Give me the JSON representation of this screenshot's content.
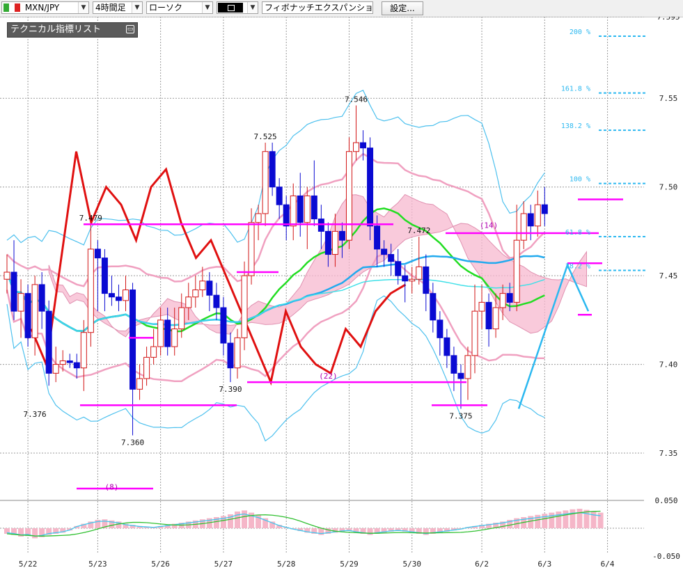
{
  "toolbar": {
    "pair": "MXN/JPY",
    "timeframe": "4時間足",
    "chart_type": "ローソク",
    "line_style": "",
    "drawing_tool": "フィボナッチエクスパンション",
    "settings_label": "設定..."
  },
  "indicator_panel": {
    "title": "テクニカル指標リスト"
  },
  "colors": {
    "bull": "#d21414",
    "bear": "#0a0ad2",
    "cloud": "#f7b8cf",
    "cloud2": "#b9d8f2",
    "bb_outer": "#4cc0ee",
    "bb_inner": "#f0a0c0",
    "ma_green": "#22dd22",
    "ma_blue": "#22aaee",
    "zigzag": "#e01010",
    "fib": "#2bb8f0",
    "level": "#ff00ff"
  },
  "chart_data": {
    "type": "candlestick",
    "ylim": [
      7.33,
      7.596
    ],
    "y_ticks": [
      {
        "v": 7.596,
        "t": "7.595"
      },
      {
        "v": 7.55,
        "t": "7.55"
      },
      {
        "v": 7.5,
        "t": "7.50"
      },
      {
        "v": 7.45,
        "t": "7.45"
      },
      {
        "v": 7.4,
        "t": "7.40"
      },
      {
        "v": 7.35,
        "t": "7.35"
      }
    ],
    "x_labels": [
      "5/22",
      "5/23",
      "5/26",
      "5/27",
      "5/28",
      "5/29",
      "5/30",
      "6/2",
      "6/3",
      "6/4"
    ],
    "x_label_index": [
      3,
      13,
      22,
      31,
      40,
      49,
      58,
      68,
      77,
      86
    ],
    "candles": [
      [
        7.448,
        7.452,
        7.462,
        7.44
      ],
      [
        7.452,
        7.43,
        7.47,
        7.425
      ],
      [
        7.43,
        7.44,
        7.448,
        7.415
      ],
      [
        7.44,
        7.415,
        7.445,
        7.41
      ],
      [
        7.415,
        7.445,
        7.45,
        7.405
      ],
      [
        7.445,
        7.43,
        7.452,
        7.42
      ],
      [
        7.43,
        7.395,
        7.436,
        7.388
      ],
      [
        7.395,
        7.4,
        7.41,
        7.39
      ],
      [
        7.4,
        7.402,
        7.408,
        7.396
      ],
      [
        7.402,
        7.401,
        7.406,
        7.398
      ],
      [
        7.401,
        7.398,
        7.406,
        7.392
      ],
      [
        7.398,
        7.418,
        7.425,
        7.385
      ],
      [
        7.418,
        7.465,
        7.479,
        7.41
      ],
      [
        7.465,
        7.46,
        7.47,
        7.43
      ],
      [
        7.46,
        7.44,
        7.465,
        7.43
      ],
      [
        7.44,
        7.438,
        7.45,
        7.433
      ],
      [
        7.438,
        7.436,
        7.445,
        7.43
      ],
      [
        7.436,
        7.442,
        7.45,
        7.43
      ],
      [
        7.442,
        7.386,
        7.446,
        7.36
      ],
      [
        7.386,
        7.392,
        7.4,
        7.38
      ],
      [
        7.392,
        7.404,
        7.41,
        7.388
      ],
      [
        7.404,
        7.41,
        7.42,
        7.4
      ],
      [
        7.41,
        7.425,
        7.432,
        7.405
      ],
      [
        7.425,
        7.41,
        7.432,
        7.405
      ],
      [
        7.41,
        7.42,
        7.432,
        7.405
      ],
      [
        7.42,
        7.432,
        7.44,
        7.415
      ],
      [
        7.432,
        7.438,
        7.446,
        7.425
      ],
      [
        7.438,
        7.442,
        7.45,
        7.432
      ],
      [
        7.442,
        7.447,
        7.455,
        7.438
      ],
      [
        7.447,
        7.439,
        7.452,
        7.43
      ],
      [
        7.439,
        7.432,
        7.446,
        7.425
      ],
      [
        7.432,
        7.412,
        7.438,
        7.405
      ],
      [
        7.412,
        7.398,
        7.418,
        7.39
      ],
      [
        7.398,
        7.415,
        7.42,
        7.392
      ],
      [
        7.415,
        7.45,
        7.458,
        7.408
      ],
      [
        7.45,
        7.48,
        7.488,
        7.445
      ],
      [
        7.48,
        7.485,
        7.49,
        7.47
      ],
      [
        7.485,
        7.52,
        7.525,
        7.478
      ],
      [
        7.52,
        7.5,
        7.525,
        7.495
      ],
      [
        7.5,
        7.49,
        7.505,
        7.482
      ],
      [
        7.49,
        7.478,
        7.495,
        7.47
      ],
      [
        7.478,
        7.495,
        7.502,
        7.47
      ],
      [
        7.495,
        7.48,
        7.508,
        7.472
      ],
      [
        7.48,
        7.495,
        7.5,
        7.465
      ],
      [
        7.495,
        7.482,
        7.515,
        7.478
      ],
      [
        7.482,
        7.475,
        7.49,
        7.465
      ],
      [
        7.475,
        7.462,
        7.48,
        7.455
      ],
      [
        7.462,
        7.475,
        7.485,
        7.455
      ],
      [
        7.475,
        7.47,
        7.48,
        7.46
      ],
      [
        7.47,
        7.52,
        7.528,
        7.465
      ],
      [
        7.52,
        7.525,
        7.546,
        7.515
      ],
      [
        7.525,
        7.522,
        7.532,
        7.515
      ],
      [
        7.522,
        7.478,
        7.528,
        7.47
      ],
      [
        7.478,
        7.465,
        7.484,
        7.455
      ],
      [
        7.465,
        7.462,
        7.47,
        7.455
      ],
      [
        7.462,
        7.458,
        7.468,
        7.45
      ],
      [
        7.458,
        7.45,
        7.465,
        7.445
      ],
      [
        7.45,
        7.447,
        7.456,
        7.435
      ],
      [
        7.447,
        7.448,
        7.455,
        7.44
      ],
      [
        7.448,
        7.455,
        7.472,
        7.445
      ],
      [
        7.455,
        7.44,
        7.462,
        7.43
      ],
      [
        7.44,
        7.425,
        7.446,
        7.418
      ],
      [
        7.425,
        7.415,
        7.43,
        7.405
      ],
      [
        7.415,
        7.405,
        7.42,
        7.398
      ],
      [
        7.405,
        7.395,
        7.41,
        7.385
      ],
      [
        7.395,
        7.392,
        7.4,
        7.375
      ],
      [
        7.392,
        7.405,
        7.41,
        7.38
      ],
      [
        7.405,
        7.43,
        7.445,
        7.395
      ],
      [
        7.43,
        7.435,
        7.445,
        7.42
      ],
      [
        7.435,
        7.42,
        7.44,
        7.41
      ],
      [
        7.42,
        7.432,
        7.44,
        7.415
      ],
      [
        7.432,
        7.44,
        7.445,
        7.425
      ],
      [
        7.44,
        7.435,
        7.446,
        7.43
      ],
      [
        7.435,
        7.47,
        7.49,
        7.43
      ],
      [
        7.47,
        7.485,
        7.492,
        7.465
      ],
      [
        7.485,
        7.478,
        7.49,
        7.47
      ],
      [
        7.478,
        7.49,
        7.498,
        7.472
      ],
      [
        7.49,
        7.485,
        7.5,
        7.478
      ]
    ],
    "annotations": [
      {
        "t": "7.479",
        "i": 12,
        "v": 7.479,
        "pos": "above"
      },
      {
        "t": "7.376",
        "i": 4,
        "v": 7.376,
        "pos": "below"
      },
      {
        "t": "7.360",
        "i": 18,
        "v": 7.36,
        "pos": "below"
      },
      {
        "t": "7.525",
        "i": 37,
        "v": 7.525,
        "pos": "above"
      },
      {
        "t": "7.390",
        "i": 32,
        "v": 7.39,
        "pos": "below"
      },
      {
        "t": "7.546",
        "i": 50,
        "v": 7.546,
        "pos": "above"
      },
      {
        "t": "7.472",
        "i": 59,
        "v": 7.472,
        "pos": "above"
      },
      {
        "t": "7.375",
        "i": 65,
        "v": 7.375,
        "pos": "below"
      },
      {
        "t": "(14)",
        "i": 69,
        "v": 7.475,
        "pos": "above"
      },
      {
        "t": "(22)",
        "i": 46,
        "v": 7.39,
        "pos": "above"
      },
      {
        "t": "(8)",
        "i": 15,
        "v": 7.335,
        "pos": "below"
      }
    ],
    "fib_levels": [
      {
        "t": "200 %",
        "v": 7.585
      },
      {
        "t": "161.8 %",
        "v": 7.553
      },
      {
        "t": "138.2 %",
        "v": 7.532
      },
      {
        "t": "100 %",
        "v": 7.502
      },
      {
        "t": "61.8 %",
        "v": 7.472
      },
      {
        "t": "38.2 %",
        "v": 7.453
      }
    ],
    "oscillator": {
      "y_ticks": [
        {
          "v": 0.05,
          "t": "0.050"
        },
        {
          "v": -0.05,
          "t": "-0.050"
        }
      ],
      "bars": [
        -0.01,
        -0.012,
        -0.015,
        -0.014,
        -0.018,
        -0.016,
        -0.012,
        -0.01,
        -0.008,
        -0.004,
        0.004,
        0.008,
        0.012,
        0.015,
        0.016,
        0.014,
        0.012,
        0.008,
        0.006,
        0.004,
        0.003,
        0.002,
        0.004,
        0.006,
        0.008,
        0.01,
        0.012,
        0.014,
        0.016,
        0.018,
        0.02,
        0.022,
        0.025,
        0.03,
        0.032,
        0.028,
        0.024,
        0.018,
        0.012,
        0.006,
        0.002,
        -0.002,
        -0.005,
        -0.008,
        -0.01,
        -0.012,
        -0.01,
        -0.008,
        -0.006,
        -0.005,
        -0.008,
        -0.01,
        -0.012,
        -0.01,
        -0.008,
        -0.006,
        -0.005,
        -0.006,
        -0.008,
        -0.01,
        -0.012,
        -0.01,
        -0.008,
        -0.006,
        -0.004,
        -0.002,
        0.002,
        0.004,
        0.006,
        0.008,
        0.01,
        0.012,
        0.015,
        0.018,
        0.02,
        0.022,
        0.024,
        0.026,
        0.028,
        0.03,
        0.032,
        0.034,
        0.035,
        0.033,
        0.03,
        0.028
      ]
    }
  }
}
